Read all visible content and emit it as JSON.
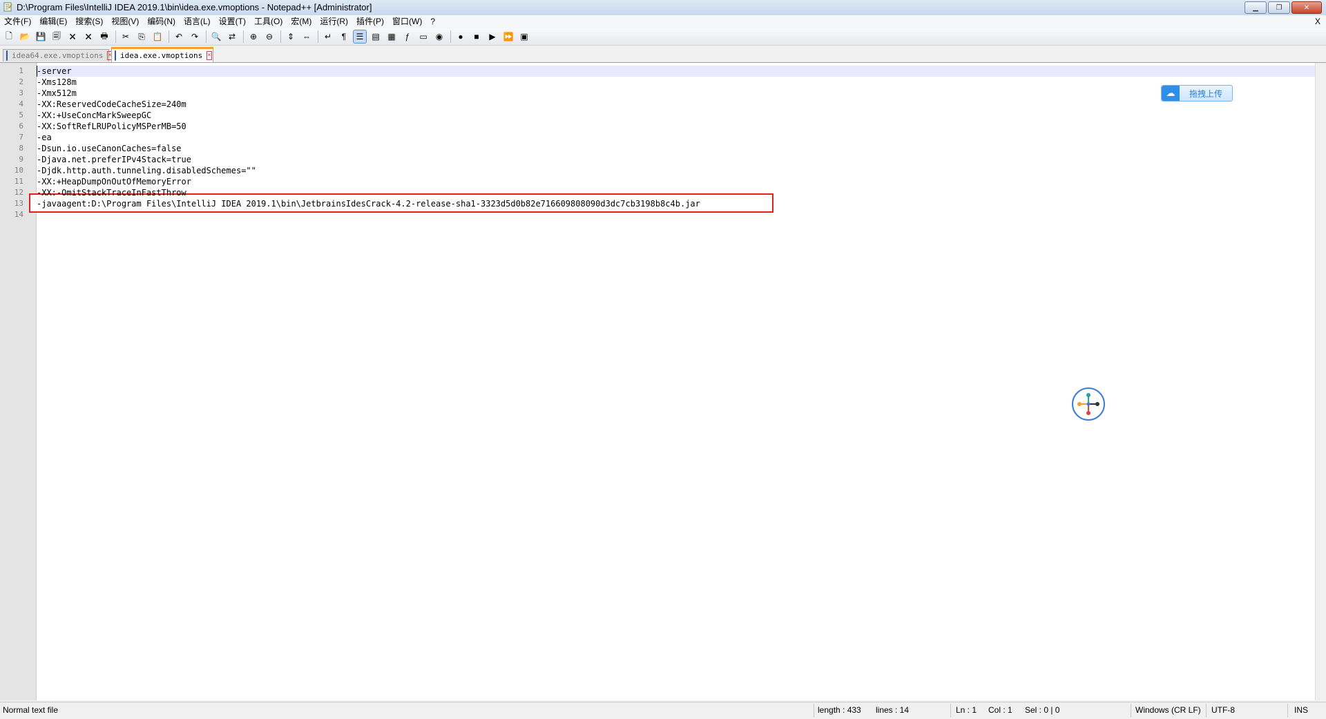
{
  "window": {
    "title": "D:\\Program Files\\IntelliJ IDEA 2019.1\\bin\\idea.exe.vmoptions - Notepad++ [Administrator]",
    "minimize_label": "▁",
    "maximize_label": "❐",
    "close_label": "✕"
  },
  "menu": {
    "items": [
      "文件(F)",
      "编辑(E)",
      "搜索(S)",
      "视图(V)",
      "编码(N)",
      "语言(L)",
      "设置(T)",
      "工具(O)",
      "宏(M)",
      "运行(R)",
      "插件(P)",
      "窗口(W)",
      "?"
    ],
    "close_doc": "X"
  },
  "toolbar": {
    "buttons": [
      {
        "icon": "new-file-icon",
        "glyph": "🗋"
      },
      {
        "icon": "open-file-icon",
        "glyph": "📂"
      },
      {
        "icon": "save-icon",
        "glyph": "💾"
      },
      {
        "icon": "save-all-icon",
        "glyph": "🗐"
      },
      {
        "icon": "close-file-icon",
        "glyph": "🗙"
      },
      {
        "icon": "close-all-icon",
        "glyph": "🗙"
      },
      {
        "icon": "print-icon",
        "glyph": "🖶"
      },
      {
        "sep": true
      },
      {
        "icon": "cut-icon",
        "glyph": "✂"
      },
      {
        "icon": "copy-icon",
        "glyph": "⎘"
      },
      {
        "icon": "paste-icon",
        "glyph": "📋"
      },
      {
        "sep": true
      },
      {
        "icon": "undo-icon",
        "glyph": "↶"
      },
      {
        "icon": "redo-icon",
        "glyph": "↷"
      },
      {
        "sep": true
      },
      {
        "icon": "find-icon",
        "glyph": "🔍"
      },
      {
        "icon": "replace-icon",
        "glyph": "⇄"
      },
      {
        "sep": true
      },
      {
        "icon": "zoom-in-icon",
        "glyph": "⊕"
      },
      {
        "icon": "zoom-out-icon",
        "glyph": "⊖"
      },
      {
        "sep": true
      },
      {
        "icon": "sync-vertical-icon",
        "glyph": "⇕"
      },
      {
        "icon": "sync-horizontal-icon",
        "glyph": "⇔"
      },
      {
        "sep": true
      },
      {
        "icon": "word-wrap-icon",
        "glyph": "↵"
      },
      {
        "icon": "show-all-chars-icon",
        "glyph": "¶"
      },
      {
        "icon": "indent-guide-icon",
        "glyph": "☰",
        "active": true
      },
      {
        "icon": "udl-icon",
        "glyph": "▤"
      },
      {
        "icon": "doc-map-icon",
        "glyph": "▦"
      },
      {
        "icon": "function-list-icon",
        "glyph": "ƒ"
      },
      {
        "icon": "folder-workspace-icon",
        "glyph": "▭"
      },
      {
        "icon": "monitoring-icon",
        "glyph": "◉"
      },
      {
        "sep": true
      },
      {
        "icon": "record-macro-icon",
        "glyph": "●"
      },
      {
        "icon": "stop-macro-icon",
        "glyph": "■"
      },
      {
        "icon": "play-macro-icon",
        "glyph": "▶"
      },
      {
        "icon": "run-macro-multiple-icon",
        "glyph": "⏩"
      },
      {
        "icon": "save-macro-icon",
        "glyph": "▣"
      }
    ]
  },
  "tabs": [
    {
      "label": "idea64.exe.vmoptions",
      "active": false
    },
    {
      "label": "idea.exe.vmoptions",
      "active": true
    }
  ],
  "editor": {
    "lines": [
      "-server",
      "-Xms128m",
      "-Xmx512m",
      "-XX:ReservedCodeCacheSize=240m",
      "-XX:+UseConcMarkSweepGC",
      "-XX:SoftRefLRUPolicyMSPerMB=50",
      "-ea",
      "-Dsun.io.useCanonCaches=false",
      "-Djava.net.preferIPv4Stack=true",
      "-Djdk.http.auth.tunneling.disabledSchemes=\"\"",
      "-XX:+HeapDumpOnOutOfMemoryError",
      "-XX:-OmitStackTraceInFastThrow",
      "-javaagent:D:\\Program Files\\IntelliJ IDEA 2019.1\\bin\\JetbrainsIdesCrack-4.2-release-sha1-3323d5d0b82e716609808090d3dc7cb3198b8c4b.jar",
      ""
    ],
    "highlighted_line": 13
  },
  "upload_widget": {
    "label": "拖拽上传"
  },
  "status": {
    "file_type": "Normal text file",
    "length": "length : 433",
    "lines": "lines : 14",
    "ln": "Ln : 1",
    "col": "Col : 1",
    "sel": "Sel : 0 | 0",
    "eol": "Windows (CR LF)",
    "encoding": "UTF-8",
    "mode": "INS"
  }
}
